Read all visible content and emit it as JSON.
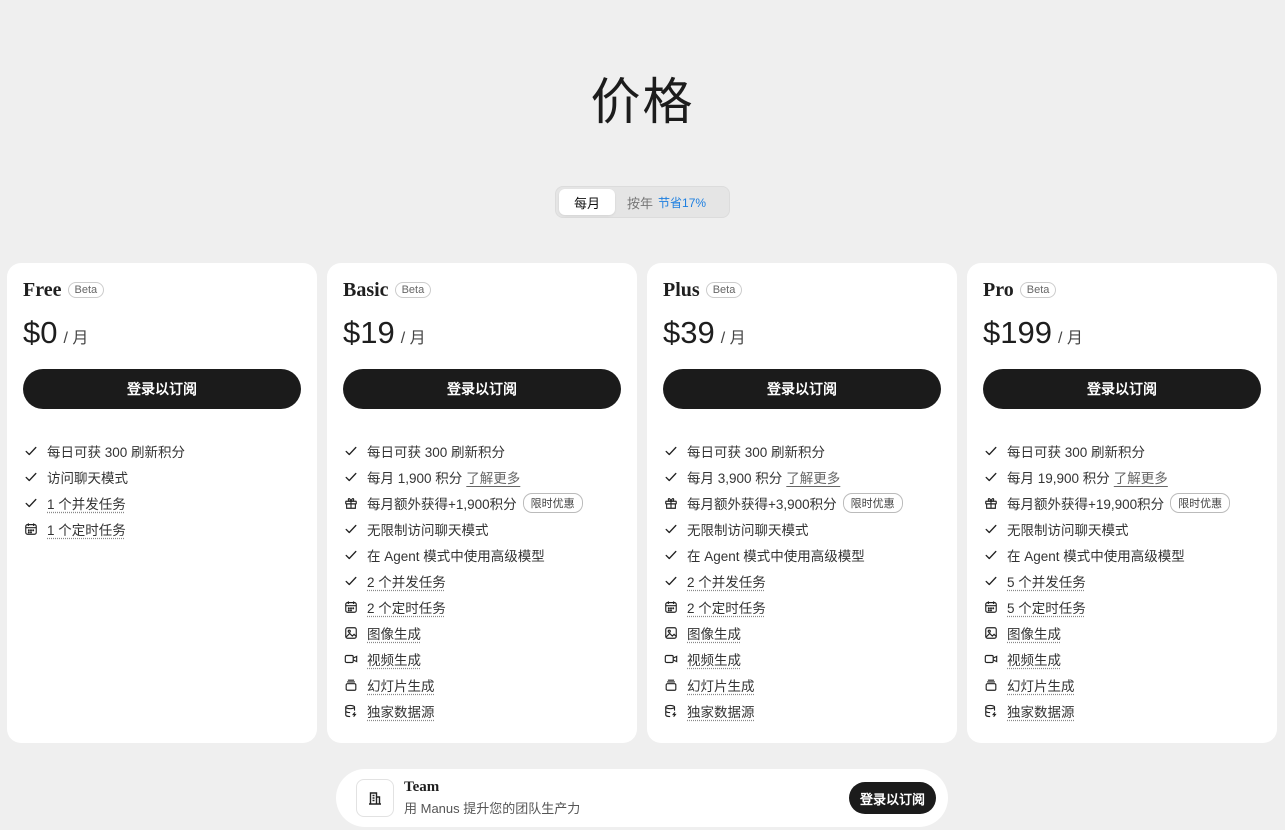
{
  "page": {
    "title": "价格"
  },
  "billing": {
    "monthly_label": "每月",
    "yearly_label": "按年",
    "yearly_discount": "节省17%"
  },
  "plans": [
    {
      "name": "Free",
      "badge": "Beta",
      "price": "$0",
      "period": "/ 月",
      "cta": "登录以订阅",
      "features": [
        {
          "icon": "check-icon",
          "text": "每日可获 300 刷新积分"
        },
        {
          "icon": "check-icon",
          "text": "访问聊天模式"
        },
        {
          "icon": "check-icon",
          "text": "1 个并发任务",
          "dotted": true
        },
        {
          "icon": "calendar-icon",
          "text": "1 个定时任务",
          "dotted": true
        }
      ]
    },
    {
      "name": "Basic",
      "badge": "Beta",
      "price": "$19",
      "period": "/ 月",
      "cta": "登录以订阅",
      "features": [
        {
          "icon": "check-icon",
          "text": "每日可获 300 刷新积分"
        },
        {
          "icon": "check-icon",
          "text": "每月 1,900 积分",
          "link": "了解更多"
        },
        {
          "icon": "gift-icon",
          "text": "每月额外获得+1,900积分",
          "tag": "限时优惠"
        },
        {
          "icon": "check-icon",
          "text": "无限制访问聊天模式"
        },
        {
          "icon": "check-icon",
          "text": "在 Agent 模式中使用高级模型"
        },
        {
          "icon": "check-icon",
          "text": "2 个并发任务",
          "dotted": true
        },
        {
          "icon": "calendar-icon",
          "text": "2 个定时任务",
          "dotted": true
        },
        {
          "icon": "image-icon",
          "text": "图像生成",
          "dotted": true
        },
        {
          "icon": "video-icon",
          "text": "视频生成",
          "dotted": true
        },
        {
          "icon": "slides-icon",
          "text": "幻灯片生成",
          "dotted": true
        },
        {
          "icon": "database-icon",
          "text": "独家数据源",
          "dotted": true
        }
      ]
    },
    {
      "name": "Plus",
      "badge": "Beta",
      "price": "$39",
      "period": "/ 月",
      "cta": "登录以订阅",
      "features": [
        {
          "icon": "check-icon",
          "text": "每日可获 300 刷新积分"
        },
        {
          "icon": "check-icon",
          "text": "每月 3,900 积分",
          "link": "了解更多"
        },
        {
          "icon": "gift-icon",
          "text": "每月额外获得+3,900积分",
          "tag": "限时优惠"
        },
        {
          "icon": "check-icon",
          "text": "无限制访问聊天模式"
        },
        {
          "icon": "check-icon",
          "text": "在 Agent 模式中使用高级模型"
        },
        {
          "icon": "check-icon",
          "text": "2 个并发任务",
          "dotted": true
        },
        {
          "icon": "calendar-icon",
          "text": "2 个定时任务",
          "dotted": true
        },
        {
          "icon": "image-icon",
          "text": "图像生成",
          "dotted": true
        },
        {
          "icon": "video-icon",
          "text": "视频生成",
          "dotted": true
        },
        {
          "icon": "slides-icon",
          "text": "幻灯片生成",
          "dotted": true
        },
        {
          "icon": "database-icon",
          "text": "独家数据源",
          "dotted": true
        }
      ]
    },
    {
      "name": "Pro",
      "badge": "Beta",
      "price": "$199",
      "period": "/ 月",
      "cta": "登录以订阅",
      "features": [
        {
          "icon": "check-icon",
          "text": "每日可获 300 刷新积分"
        },
        {
          "icon": "check-icon",
          "text": "每月 19,900 积分",
          "link": "了解更多"
        },
        {
          "icon": "gift-icon",
          "text": "每月额外获得+19,900积分",
          "tag": "限时优惠"
        },
        {
          "icon": "check-icon",
          "text": "无限制访问聊天模式"
        },
        {
          "icon": "check-icon",
          "text": "在 Agent 模式中使用高级模型"
        },
        {
          "icon": "check-icon",
          "text": "5 个并发任务",
          "dotted": true
        },
        {
          "icon": "calendar-icon",
          "text": "5 个定时任务",
          "dotted": true
        },
        {
          "icon": "image-icon",
          "text": "图像生成",
          "dotted": true
        },
        {
          "icon": "video-icon",
          "text": "视频生成",
          "dotted": true
        },
        {
          "icon": "slides-icon",
          "text": "幻灯片生成",
          "dotted": true
        },
        {
          "icon": "database-icon",
          "text": "独家数据源",
          "dotted": true
        }
      ]
    }
  ],
  "team": {
    "icon": "building-icon",
    "name": "Team",
    "description": "用 Manus 提升您的团队生产力",
    "cta": "登录以订阅"
  }
}
